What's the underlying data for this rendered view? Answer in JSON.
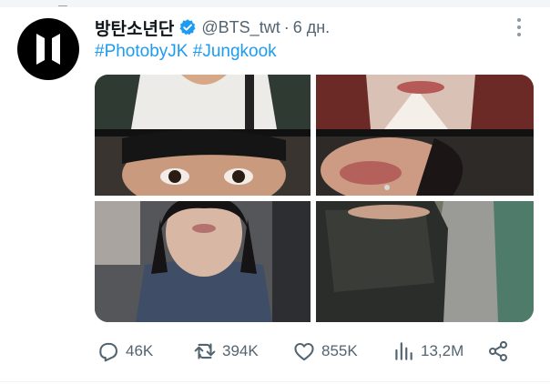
{
  "tweet": {
    "author": {
      "display_name": "방탄소년단",
      "handle": "@BTS_twt",
      "verified": true,
      "avatar_icon": "bts-logo-icon"
    },
    "separator": "·",
    "time": "6 дн.",
    "hashtags": [
      "#PhotobyJK",
      "#Jungkook"
    ],
    "media": [
      {
        "description_icon": "photo-white-tshirt-icon"
      },
      {
        "description_icon": "photo-lip-piercing-icon"
      },
      {
        "description_icon": "photo-portrait-icon"
      },
      {
        "description_icon": "photo-face-mask-icon"
      }
    ],
    "actions": {
      "replies": "46K",
      "retweets": "394K",
      "likes": "855K",
      "views": "13,2M"
    }
  },
  "colors": {
    "accent": "#1d9bf0",
    "text_primary": "#0f1419",
    "text_secondary": "#536471",
    "avatar_bg": "#000000"
  }
}
